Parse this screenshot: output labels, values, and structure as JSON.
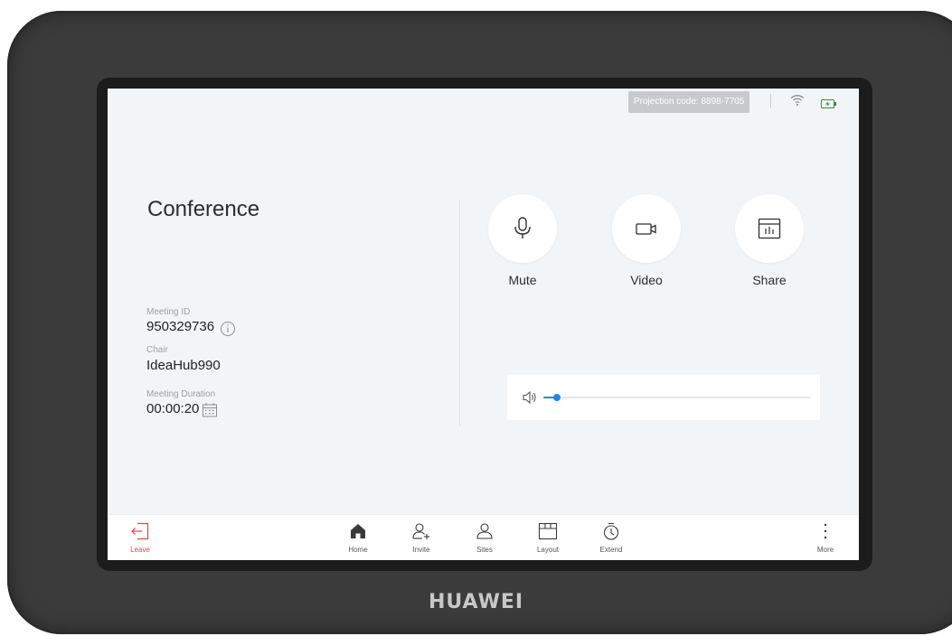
{
  "status_bar": {
    "projection_code": "Projection code: 8898-7705",
    "icons": [
      "wifi-icon",
      "battery-icon"
    ]
  },
  "meeting": {
    "title": "Conference",
    "meeting_id_label": "Meeting ID",
    "meeting_id": "950329736",
    "chair_label": "Chair",
    "chair": "IdeaHub990",
    "duration_label": "Meeting Duration",
    "duration": "00:00:20"
  },
  "controls": {
    "mute_label": "Mute",
    "video_label": "Video",
    "share_label": "Share"
  },
  "volume": {
    "level_percent": 5,
    "icon": "speaker-icon"
  },
  "bottom_nav": {
    "leave_label": "Leave",
    "home_label": "Home",
    "invite_label": "Invite",
    "sites_label": "Sites",
    "layout_label": "Layout",
    "extend_label": "Extend",
    "more_label": "More"
  },
  "device": {
    "brand": "HUAWEI"
  },
  "colors": {
    "accent": "#1f87e5",
    "danger": "#e8403f",
    "screen_background": "#f2f5f8",
    "bezel": "#3b3b3b"
  }
}
